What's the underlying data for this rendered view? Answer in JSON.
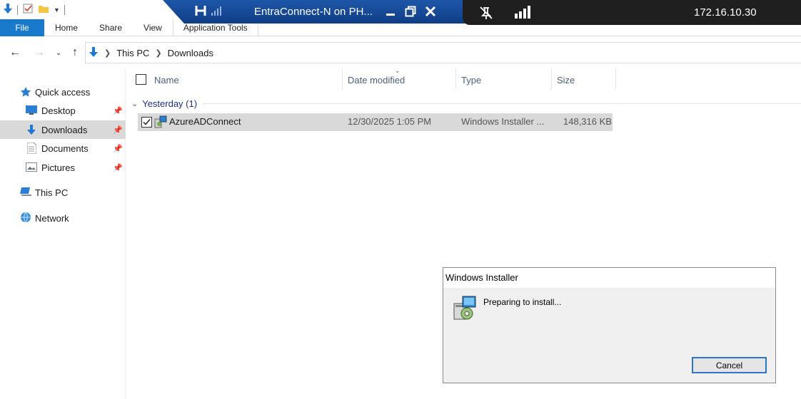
{
  "ribbon": {
    "tabs": [
      "File",
      "Home",
      "Share",
      "View",
      "Application Tools"
    ]
  },
  "rdp": {
    "title": "EntraConnect-N on PH...",
    "ip": "172.16.10.30"
  },
  "address": {
    "crumbs": [
      "This PC",
      "Downloads"
    ]
  },
  "nav": {
    "items": [
      {
        "label": "Quick access",
        "icon": "star-icon"
      },
      {
        "label": "Desktop",
        "icon": "desktop-icon",
        "pinned": true
      },
      {
        "label": "Downloads",
        "icon": "downloads-icon",
        "pinned": true,
        "selected": true
      },
      {
        "label": "Documents",
        "icon": "documents-icon",
        "pinned": true
      },
      {
        "label": "Pictures",
        "icon": "pictures-icon",
        "pinned": true
      },
      {
        "label": "This PC",
        "icon": "computer-icon"
      },
      {
        "label": "Network",
        "icon": "network-icon"
      }
    ]
  },
  "columns": {
    "name": "Name",
    "date": "Date modified",
    "type": "Type",
    "size": "Size"
  },
  "group": {
    "label": "Yesterday (1)"
  },
  "files": [
    {
      "name": "AzureADConnect",
      "date": "12/30/2025 1:05 PM",
      "type": "Windows Installer ...",
      "size": "148,316 KB",
      "selected": true
    }
  ],
  "dialog": {
    "title": "Windows Installer",
    "message": "Preparing to install...",
    "cancel_label": "Cancel"
  },
  "colors": {
    "accent": "#1979ca",
    "rdp_bar": "#1a4fa0",
    "status_bar": "#1f1f1f",
    "selection": "#d9d9d9",
    "group_text": "#1e3287"
  }
}
